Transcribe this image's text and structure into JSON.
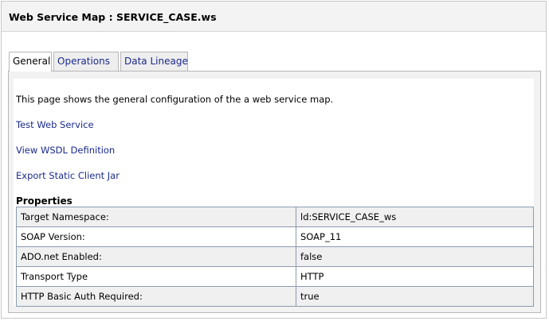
{
  "header": {
    "title": "Web Service Map : SERVICE_CASE.ws"
  },
  "tabs": [
    {
      "label": "General"
    },
    {
      "label": "Operations"
    },
    {
      "label": "Data Lineage"
    }
  ],
  "general": {
    "intro": "This page shows the general configuration of the a web service map.",
    "links": [
      {
        "label": "Test Web Service"
      },
      {
        "label": "View WSDL Definition"
      },
      {
        "label": "Export Static Client Jar"
      }
    ],
    "properties_heading": "Properties",
    "properties": [
      {
        "key": "Target Namespace:",
        "value": "ld:SERVICE_CASE_ws"
      },
      {
        "key": "SOAP Version:",
        "value": "SOAP_11"
      },
      {
        "key": "ADO.net Enabled:",
        "value": "false"
      },
      {
        "key": "Transport Type",
        "value": "HTTP"
      },
      {
        "key": "HTTP Basic Auth Required:",
        "value": "true"
      }
    ]
  }
}
